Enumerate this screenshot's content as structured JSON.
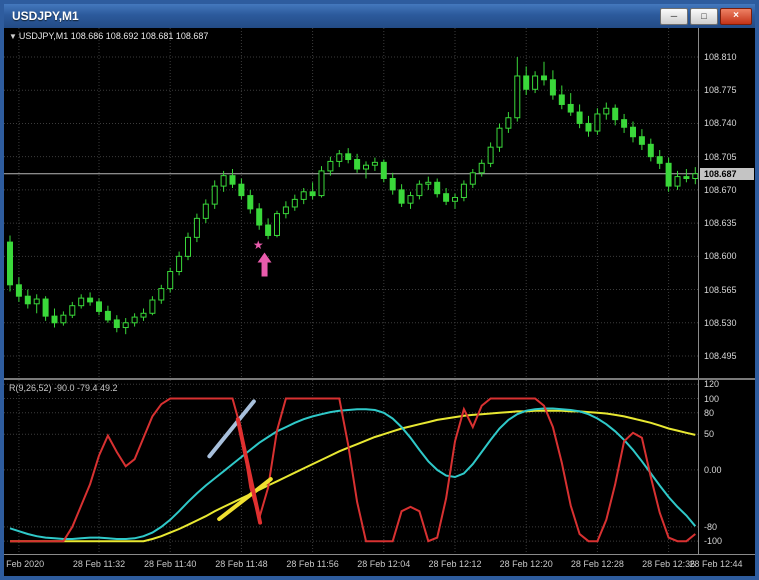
{
  "window": {
    "title": "USDJPY,M1",
    "controls": [
      {
        "name": "minimize",
        "glyph": "─"
      },
      {
        "name": "maximize",
        "glyph": "□"
      },
      {
        "name": "close",
        "glyph": "×"
      }
    ]
  },
  "chart": {
    "header": {
      "tick_icon": "▼",
      "text": "USDJPY,M1 108.686 108.692 108.681 108.687"
    },
    "price_axis_labels": [
      "108.810",
      "108.775",
      "108.740",
      "108.705",
      "108.670",
      "108.635",
      "108.600",
      "108.565",
      "108.530",
      "108.495"
    ],
    "current_price": "108.687",
    "time_axis_labels": [
      {
        "text": "28 Feb 2020",
        "i": 1
      },
      {
        "text": "28 Feb 11:32",
        "i": 10
      },
      {
        "text": "28 Feb 11:40",
        "i": 18
      },
      {
        "text": "28 Feb 11:48",
        "i": 26
      },
      {
        "text": "28 Feb 11:56",
        "i": 34
      },
      {
        "text": "28 Feb 12:04",
        "i": 42
      },
      {
        "text": "28 Feb 12:12",
        "i": 50
      },
      {
        "text": "28 Feb 12:20",
        "i": 58
      },
      {
        "text": "28 Feb 12:28",
        "i": 66
      },
      {
        "text": "28 Feb 12:36",
        "i": 74
      },
      {
        "text": "28 Feb 12:44",
        "i": 82
      }
    ]
  },
  "indicator": {
    "header": "R(9,26,52) -90.0 -79.4 49.2",
    "axis_labels": [
      {
        "text": "120",
        "v": 120
      },
      {
        "text": "100",
        "v": 100
      },
      {
        "text": "80",
        "v": 80
      },
      {
        "text": "50",
        "v": 50
      },
      {
        "text": "0.00",
        "v": 0
      },
      {
        "text": "-80",
        "v": -80
      },
      {
        "text": "-100",
        "v": -100
      }
    ]
  },
  "chart_data": {
    "type": "candlestick",
    "symbol": "USDJPY",
    "timeframe": "M1",
    "title": "USDJPY,M1",
    "ohlc_display": {
      "open": "108.686",
      "high": "108.692",
      "low": "108.681",
      "close": "108.687"
    },
    "price_range": {
      "max": 108.81,
      "min": 108.495
    },
    "bid": 108.687,
    "colors": {
      "candle": "#3ad83a",
      "bull_fill": "#000000",
      "bear_fill": "#3ad83a",
      "grid": "#3c3c3c",
      "bid_line": "#b8b8b8",
      "annotation_pink": "#e95bac"
    },
    "candles": [
      [
        108.615,
        108.622,
        108.563,
        108.57
      ],
      [
        108.57,
        108.578,
        108.552,
        108.558
      ],
      [
        108.558,
        108.565,
        108.545,
        108.55
      ],
      [
        108.55,
        108.56,
        108.54,
        108.555
      ],
      [
        108.555,
        108.558,
        108.532,
        108.537
      ],
      [
        108.537,
        108.545,
        108.525,
        108.53
      ],
      [
        108.53,
        108.542,
        108.527,
        108.538
      ],
      [
        108.538,
        108.552,
        108.535,
        108.548
      ],
      [
        108.548,
        108.56,
        108.545,
        108.556
      ],
      [
        108.556,
        108.562,
        108.548,
        108.552
      ],
      [
        108.552,
        108.556,
        108.538,
        108.542
      ],
      [
        108.542,
        108.548,
        108.53,
        108.533
      ],
      [
        108.533,
        108.538,
        108.52,
        108.525
      ],
      [
        108.525,
        108.535,
        108.518,
        108.53
      ],
      [
        108.53,
        108.54,
        108.526,
        108.536
      ],
      [
        108.536,
        108.545,
        108.532,
        108.54
      ],
      [
        108.54,
        108.558,
        108.538,
        108.554
      ],
      [
        108.554,
        108.57,
        108.55,
        108.566
      ],
      [
        108.566,
        108.588,
        108.562,
        108.584
      ],
      [
        108.584,
        108.605,
        108.58,
        108.6
      ],
      [
        108.6,
        108.625,
        108.596,
        108.62
      ],
      [
        108.62,
        108.645,
        108.615,
        108.64
      ],
      [
        108.64,
        108.66,
        108.635,
        108.655
      ],
      [
        108.655,
        108.68,
        108.65,
        108.674
      ],
      [
        108.674,
        108.69,
        108.668,
        108.685
      ],
      [
        108.685,
        108.692,
        108.672,
        108.676
      ],
      [
        108.676,
        108.682,
        108.66,
        108.664
      ],
      [
        108.664,
        108.67,
        108.645,
        108.65
      ],
      [
        108.65,
        108.656,
        108.628,
        108.633
      ],
      [
        108.633,
        108.64,
        108.618,
        108.622
      ],
      [
        108.622,
        108.648,
        108.62,
        108.645
      ],
      [
        108.645,
        108.658,
        108.64,
        108.652
      ],
      [
        108.652,
        108.665,
        108.648,
        108.66
      ],
      [
        108.66,
        108.672,
        108.655,
        108.668
      ],
      [
        108.668,
        108.678,
        108.66,
        108.664
      ],
      [
        108.664,
        108.695,
        108.662,
        108.69
      ],
      [
        108.69,
        108.705,
        108.685,
        108.7
      ],
      [
        108.7,
        108.712,
        108.694,
        108.708
      ],
      [
        108.708,
        108.714,
        108.698,
        108.702
      ],
      [
        108.702,
        108.708,
        108.688,
        108.692
      ],
      [
        108.692,
        108.7,
        108.682,
        108.696
      ],
      [
        108.696,
        108.704,
        108.69,
        108.699
      ],
      [
        108.699,
        108.702,
        108.678,
        108.682
      ],
      [
        108.682,
        108.688,
        108.665,
        108.67
      ],
      [
        108.67,
        108.676,
        108.652,
        108.656
      ],
      [
        108.656,
        108.668,
        108.65,
        108.664
      ],
      [
        108.664,
        108.68,
        108.66,
        108.676
      ],
      [
        108.676,
        108.684,
        108.67,
        108.678
      ],
      [
        108.678,
        108.682,
        108.662,
        108.666
      ],
      [
        108.666,
        108.672,
        108.654,
        108.658
      ],
      [
        108.658,
        108.666,
        108.65,
        108.662
      ],
      [
        108.662,
        108.68,
        108.658,
        108.676
      ],
      [
        108.676,
        108.692,
        108.672,
        108.688
      ],
      [
        108.688,
        108.702,
        108.684,
        108.698
      ],
      [
        108.698,
        108.72,
        108.694,
        108.715
      ],
      [
        108.715,
        108.74,
        108.71,
        108.735
      ],
      [
        108.735,
        108.752,
        108.73,
        108.746
      ],
      [
        108.746,
        108.81,
        108.742,
        108.79
      ],
      [
        108.79,
        108.8,
        108.77,
        108.776
      ],
      [
        108.776,
        108.795,
        108.772,
        108.79
      ],
      [
        108.79,
        108.805,
        108.78,
        108.786
      ],
      [
        108.786,
        108.796,
        108.765,
        108.77
      ],
      [
        108.77,
        108.78,
        108.755,
        108.76
      ],
      [
        108.76,
        108.772,
        108.748,
        108.752
      ],
      [
        108.752,
        108.76,
        108.735,
        108.74
      ],
      [
        108.74,
        108.748,
        108.726,
        108.732
      ],
      [
        108.732,
        108.756,
        108.728,
        108.75
      ],
      [
        108.75,
        108.762,
        108.744,
        108.756
      ],
      [
        108.756,
        108.76,
        108.738,
        108.744
      ],
      [
        108.744,
        108.75,
        108.73,
        108.736
      ],
      [
        108.736,
        108.742,
        108.72,
        108.726
      ],
      [
        108.726,
        108.734,
        108.712,
        108.718
      ],
      [
        108.718,
        108.724,
        108.7,
        108.705
      ],
      [
        108.705,
        108.712,
        108.692,
        108.698
      ],
      [
        108.698,
        108.704,
        108.668,
        108.674
      ],
      [
        108.674,
        108.69,
        108.67,
        108.684
      ],
      [
        108.684,
        108.692,
        108.678,
        108.682
      ],
      [
        108.682,
        108.694,
        108.676,
        108.687
      ]
    ],
    "annotations": {
      "star": {
        "glyph": "★",
        "index": 27.9,
        "price": 108.612
      },
      "arrow_up": {
        "index": 28.6,
        "price": 108.604
      }
    },
    "oscillator": {
      "name": "R(9,26,52)",
      "current_values": [
        "-90.0",
        "-79.4",
        "49.2"
      ],
      "levels": [
        120,
        100,
        80,
        50,
        0,
        -80,
        -100
      ],
      "value_range": {
        "top": 126,
        "bottom": -118
      },
      "series": [
        {
          "name": "slow",
          "color": "#e8e832",
          "width": 2,
          "values": [
            -100,
            -100,
            -100,
            -100,
            -100,
            -100,
            -100,
            -100,
            -100,
            -100,
            -100,
            -100,
            -100,
            -100,
            -100,
            -100,
            -97,
            -93,
            -88,
            -83,
            -77,
            -71,
            -65,
            -58,
            -52,
            -46,
            -40,
            -34,
            -28,
            -22,
            -16,
            -10,
            -4,
            2,
            8,
            14,
            20,
            26,
            31,
            36,
            41,
            46,
            50,
            54,
            58,
            61,
            64,
            67,
            70,
            72,
            74,
            76,
            77,
            78,
            79,
            80,
            81,
            82,
            82,
            83,
            83,
            83,
            83,
            82,
            82,
            81,
            80,
            79,
            77,
            75,
            72,
            69,
            66,
            62,
            58,
            55,
            52,
            49
          ]
        },
        {
          "name": "mid",
          "color": "#2fc9c9",
          "width": 2,
          "values": [
            -82,
            -86,
            -90,
            -93,
            -95,
            -96,
            -97,
            -97,
            -96,
            -95,
            -95,
            -96,
            -97,
            -97,
            -96,
            -93,
            -88,
            -80,
            -70,
            -58,
            -45,
            -33,
            -22,
            -12,
            -2,
            8,
            18,
            28,
            38,
            46,
            54,
            60,
            66,
            71,
            75,
            78,
            81,
            83,
            84,
            85,
            85,
            84,
            80,
            72,
            60,
            45,
            28,
            12,
            0,
            -8,
            -10,
            -5,
            8,
            25,
            42,
            58,
            70,
            78,
            83,
            85,
            86,
            86,
            85,
            84,
            82,
            78,
            72,
            64,
            54,
            42,
            28,
            12,
            -5,
            -22,
            -38,
            -52,
            -64,
            -79
          ]
        },
        {
          "name": "fast",
          "color": "#d83131",
          "width": 2,
          "values": [
            -100,
            -100,
            -100,
            -100,
            -100,
            -100,
            -100,
            -80,
            -50,
            -20,
            20,
            48,
            25,
            5,
            15,
            45,
            75,
            92,
            100,
            100,
            100,
            100,
            100,
            100,
            100,
            100,
            55,
            -25,
            -68,
            -25,
            55,
            100,
            100,
            100,
            100,
            100,
            100,
            100,
            35,
            -45,
            -100,
            -100,
            -100,
            -100,
            -58,
            -52,
            -58,
            -100,
            -95,
            -40,
            40,
            85,
            60,
            90,
            100,
            100,
            100,
            100,
            100,
            100,
            90,
            60,
            10,
            -50,
            -90,
            -100,
            -100,
            -70,
            -20,
            40,
            52,
            45,
            -10,
            -60,
            -95,
            -100,
            -100,
            -90
          ]
        }
      ],
      "drawings": [
        {
          "name": "trendline-blue",
          "color": "#a8c0dc",
          "width": 4,
          "i1": 22.4,
          "v1": 19,
          "i2": 27.4,
          "v2": 96
        },
        {
          "name": "trendline-yellow",
          "color": "#f0e030",
          "width": 4,
          "i1": 23.5,
          "v1": -69,
          "i2": 29.3,
          "v2": -13
        },
        {
          "name": "trendline-red",
          "color": "#e03030",
          "width": 4,
          "i1": 25.6,
          "v1": 71,
          "i2": 28.1,
          "v2": -74
        }
      ]
    }
  }
}
